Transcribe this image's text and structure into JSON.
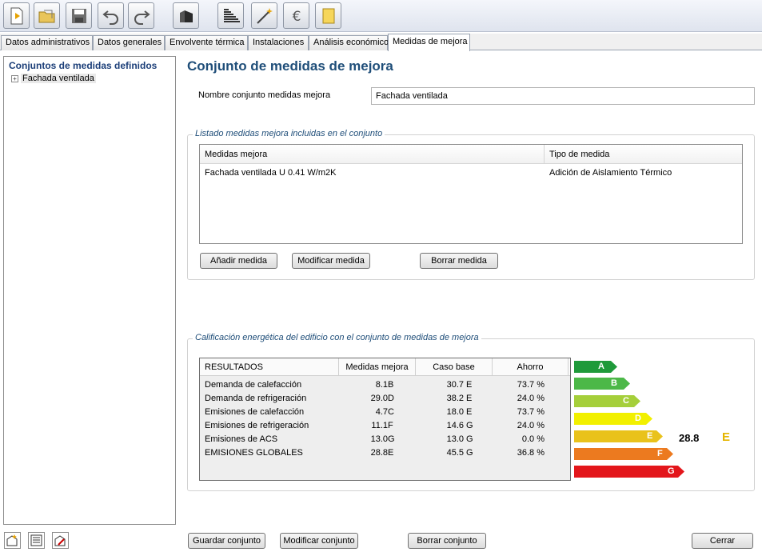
{
  "toolbar": {
    "buttons": [
      {
        "icon": "new-document-icon"
      },
      {
        "icon": "open-folder-icon"
      },
      {
        "icon": "save-icon"
      },
      {
        "icon": "undo-icon"
      },
      {
        "icon": "redo-icon"
      },
      {
        "icon": "building-icon"
      },
      {
        "icon": "energy-rating-icon"
      },
      {
        "icon": "magic-wand-icon"
      },
      {
        "icon": "euro-icon"
      },
      {
        "icon": "report-icon"
      }
    ]
  },
  "tabs": [
    {
      "label": "Datos administrativos"
    },
    {
      "label": "Datos generales"
    },
    {
      "label": "Envolvente térmica"
    },
    {
      "label": "Instalaciones"
    },
    {
      "label": "Análisis económico"
    },
    {
      "label": "Medidas de mejora",
      "active": true
    }
  ],
  "sidebar": {
    "title": "Conjuntos de medidas definidos",
    "items": [
      {
        "label": "Fachada ventilada",
        "expander": "+"
      }
    ]
  },
  "main": {
    "title": "Conjunto de medidas de mejora",
    "nombre_label": "Nombre conjunto medidas mejora",
    "nombre_value": "Fachada ventilada"
  },
  "listado": {
    "title": "Listado medidas mejora incluidas en el conjunto",
    "columns": [
      "Medidas mejora",
      "Tipo de medida"
    ],
    "rows": [
      {
        "medida": "Fachada ventilada U 0.41 W/m2K",
        "tipo": "Adición de Aislamiento Térmico"
      }
    ],
    "buttons": {
      "add": "Añadir medida",
      "modify": "Modificar medida",
      "delete": "Borrar medida"
    }
  },
  "calificacion": {
    "title": "Calificación energética del edificio con el conjunto de medidas de mejora",
    "columns": [
      "RESULTADOS",
      "Medidas mejora",
      "Caso base",
      "Ahorro"
    ],
    "rows": [
      {
        "label": "Demanda de calefacción",
        "mejora": "8.1",
        "mejora_letter": "B",
        "base": "30.7",
        "base_letter": "E",
        "ahorro": "73.7 %"
      },
      {
        "label": "Demanda de refrigeración",
        "mejora": "29.0",
        "mejora_letter": "D",
        "base": "38.2",
        "base_letter": "E",
        "ahorro": "24.0 %"
      },
      {
        "label": "Emisiones de calefacción",
        "mejora": "4.7",
        "mejora_letter": "C",
        "base": "18.0",
        "base_letter": "E",
        "ahorro": "73.7 %"
      },
      {
        "label": "Emisiones de refrigeración",
        "mejora": "11.1",
        "mejora_letter": "F",
        "base": "14.6",
        "base_letter": "G",
        "ahorro": "24.0 %"
      },
      {
        "label": "Emisiones de ACS",
        "mejora": "13.0",
        "mejora_letter": "G",
        "base": "13.0",
        "base_letter": "G",
        "ahorro": "0.0 %"
      },
      {
        "label": "EMISIONES GLOBALES",
        "mejora": "28.8",
        "mejora_letter": "E",
        "base": "45.5",
        "base_letter": "G",
        "ahorro": "36.8 %"
      }
    ],
    "scale": [
      {
        "letter": "A",
        "color": "#1f9a3a"
      },
      {
        "letter": "B",
        "color": "#4cb848"
      },
      {
        "letter": "C",
        "color": "#a5cf3a"
      },
      {
        "letter": "D",
        "color": "#f2f000"
      },
      {
        "letter": "E",
        "color": "#e9c21b"
      },
      {
        "letter": "F",
        "color": "#ec7a1f"
      },
      {
        "letter": "G",
        "color": "#e3161b"
      }
    ],
    "score": "28.8",
    "score_letter": "E"
  },
  "footer": {
    "save": "Guardar conjunto",
    "modify": "Modificar conjunto",
    "delete": "Borrar conjunto",
    "close": "Cerrar",
    "icons": [
      "new-set-icon",
      "list-icon",
      "edit-set-icon"
    ]
  }
}
